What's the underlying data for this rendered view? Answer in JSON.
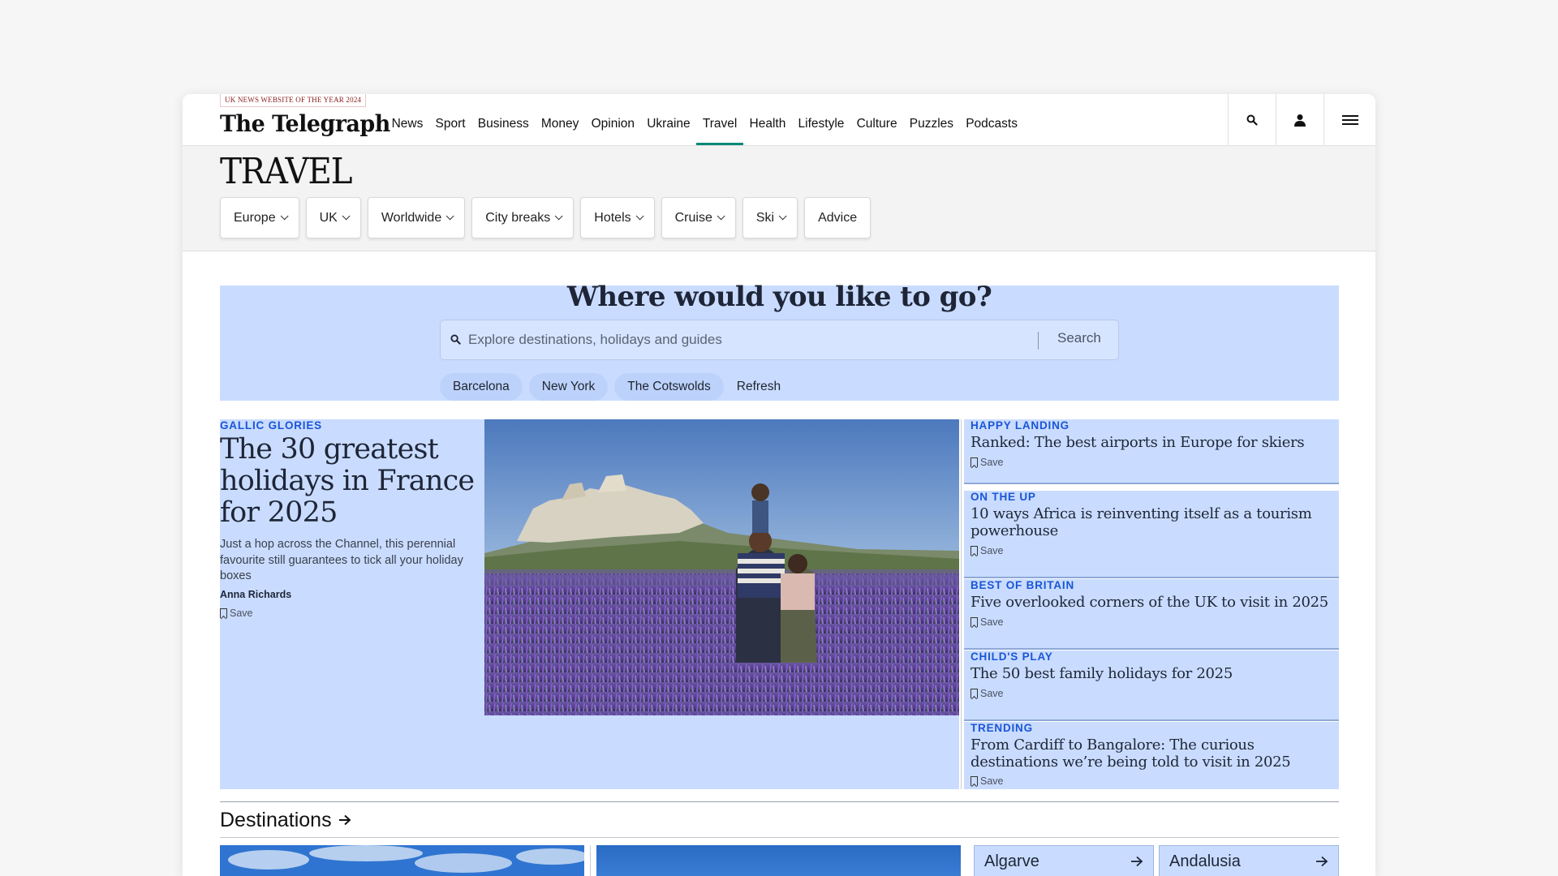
{
  "header": {
    "award": "UK NEWS WEBSITE OF THE YEAR 2024",
    "logo": "The Telegraph",
    "nav": [
      "News",
      "Sport",
      "Business",
      "Money",
      "Opinion",
      "Ukraine",
      "Travel",
      "Health",
      "Lifestyle",
      "Culture",
      "Puzzles",
      "Podcasts"
    ],
    "active_nav": "Travel",
    "icons": [
      "search-icon",
      "account-icon",
      "menu-icon"
    ]
  },
  "section": {
    "title": "TRAVEL",
    "pills": [
      {
        "label": "Europe",
        "dropdown": true
      },
      {
        "label": "UK",
        "dropdown": true
      },
      {
        "label": "Worldwide",
        "dropdown": true
      },
      {
        "label": "City breaks",
        "dropdown": true
      },
      {
        "label": "Hotels",
        "dropdown": true
      },
      {
        "label": "Cruise",
        "dropdown": true
      },
      {
        "label": "Ski",
        "dropdown": true
      },
      {
        "label": "Advice",
        "dropdown": false
      }
    ]
  },
  "search": {
    "title": "Where would you like to go?",
    "placeholder": "Explore destinations, holidays and guides",
    "button": "Search",
    "suggestions": [
      "Barcelona",
      "New York",
      "The Cotswolds"
    ],
    "refresh": "Refresh"
  },
  "lead": {
    "kicker": "GALLIC GLORIES",
    "title": "The 30 greatest holidays in France for 2025",
    "description": "Just a hop across the Channel, this perennial favourite still guarantees to tick all your holiday boxes",
    "author": "Anna Richards",
    "save": "Save"
  },
  "side_stories": [
    {
      "kicker": "HAPPY LANDING",
      "title": "Ranked: The best airports in Europe for skiers",
      "save": "Save"
    },
    {
      "kicker": "ON THE UP",
      "title": "10 ways Africa is reinventing itself as a tourism powerhouse",
      "save": "Save"
    },
    {
      "kicker": "BEST OF BRITAIN",
      "title": "Five overlooked corners of the UK to visit in 2025",
      "save": "Save"
    },
    {
      "kicker": "CHILD'S PLAY",
      "title": "The 50 best family holidays for 2025",
      "save": "Save"
    },
    {
      "kicker": "TRENDING",
      "title": "From Cardiff to Bangalore: The curious destinations we’re being told to visit in 2025",
      "save": "Save"
    }
  ],
  "destinations": {
    "heading": "Destinations",
    "cards": [
      "Algarve",
      "Andalusia"
    ]
  },
  "colors": {
    "accent_teal": "#0b8a74",
    "kicker_blue": "#1a55d6",
    "panel_blue": "#c9dcff",
    "headline_navy": "#1e2537"
  }
}
